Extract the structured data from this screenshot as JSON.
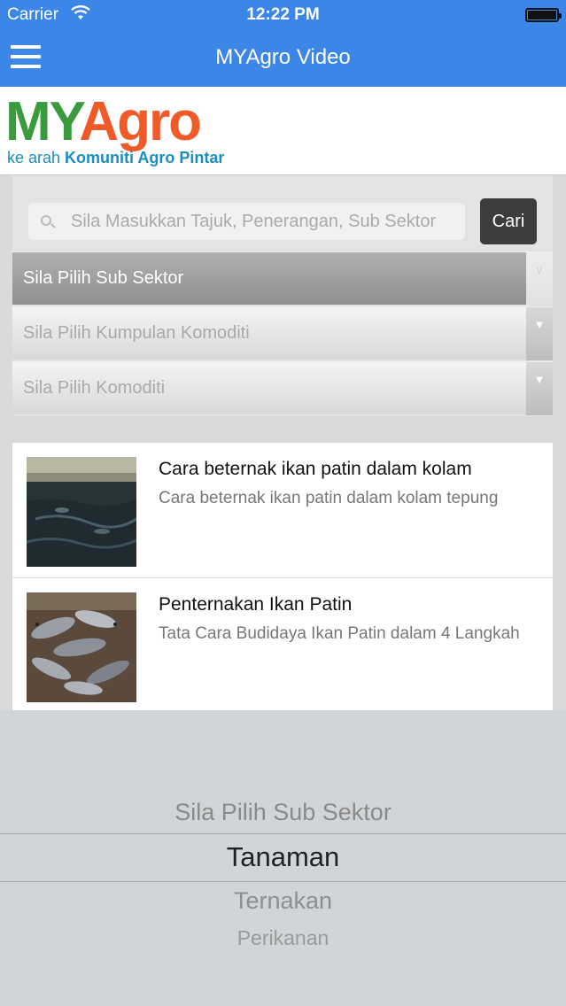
{
  "status_bar": {
    "carrier": "Carrier",
    "time": "12:22 PM"
  },
  "nav": {
    "title": "MYAgro Video",
    "menu_icon": "hamburger-menu-icon"
  },
  "logo": {
    "my": "MY",
    "agro": "Agro",
    "tagline_prefix": "ke arah ",
    "tagline_bold": "Komuniti Agro Pintar",
    "colors": {
      "my": "#3a9a3e",
      "agro": "#f05a28",
      "tagline": "#1a8ec0"
    }
  },
  "search": {
    "placeholder": "Sila Masukkan Tajuk, Penerangan, Sub Sektor",
    "button_label": "Cari"
  },
  "filters": [
    {
      "label": "Sila Pilih Sub Sektor",
      "active": true
    },
    {
      "label": "Sila Pilih Kumpulan Komoditi",
      "active": false
    },
    {
      "label": "Sila Pilih Komoditi",
      "active": false
    }
  ],
  "videos": [
    {
      "title": "Cara beternak ikan patin dalam kolam",
      "description": "Cara beternak ikan patin dalam kolam tepung"
    },
    {
      "title": "Penternakan Ikan Patin",
      "description": "Tata Cara Budidaya Ikan Patin dalam 4 Langkah"
    }
  ],
  "picker": {
    "options": [
      "Sila Pilih Sub Sektor",
      "Tanaman",
      "Ternakan",
      "Perikanan"
    ],
    "selected": "Tanaman"
  },
  "colors": {
    "nav_bar": "#3b86e6",
    "cari_button": "#3c3c3c"
  }
}
